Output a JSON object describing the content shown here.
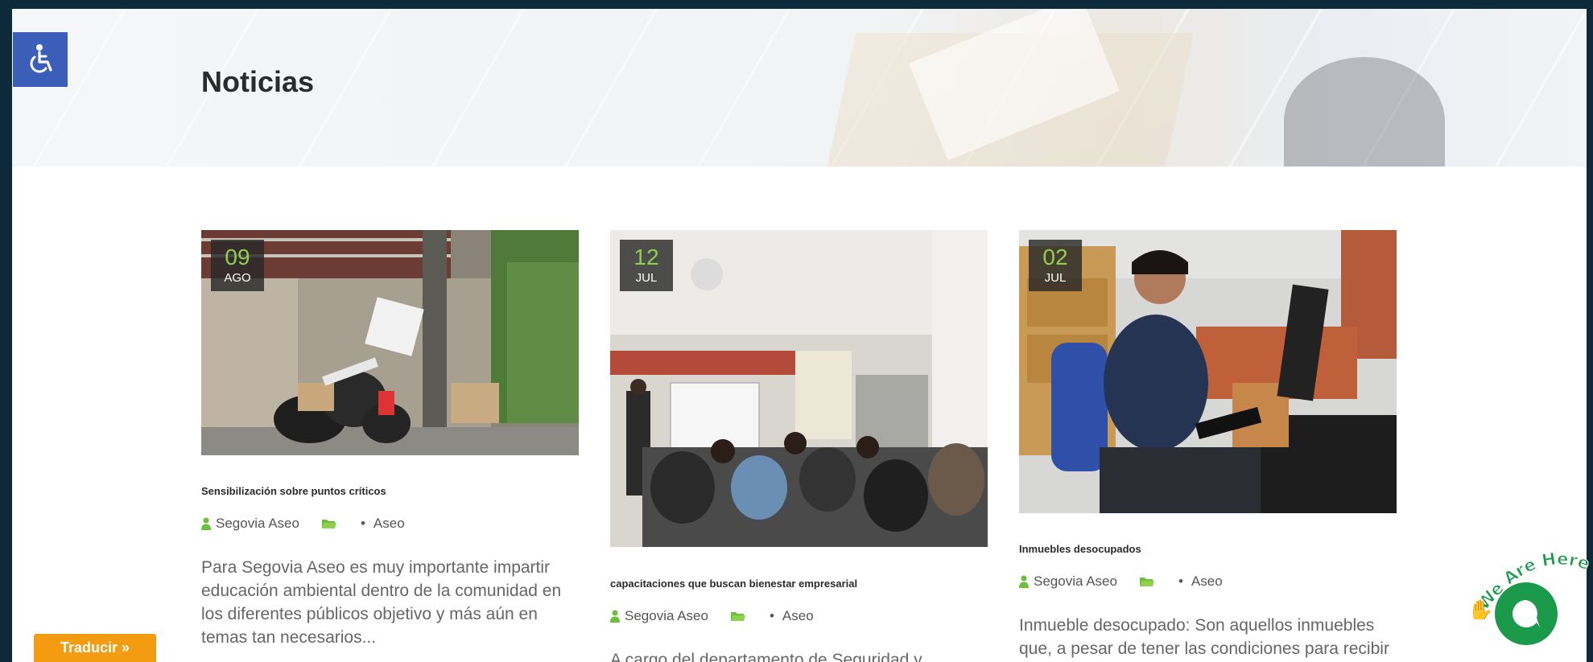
{
  "header": {
    "title": "Noticias"
  },
  "accessibility": {
    "icon": "wheelchair-icon"
  },
  "posts": [
    {
      "day": "09",
      "month": "AGO",
      "title": "Sensibilización sobre puntos críticos",
      "author": "Segovia Aseo",
      "category": "Aseo",
      "excerpt": "Para Segovia Aseo es muy importante impartir educación ambiental dentro de la comunidad en los diferentes públicos objetivo y más aún en temas tan necesarios..."
    },
    {
      "day": "12",
      "month": "JUL",
      "title": "capacitaciones que buscan bienestar empresarial",
      "author": "Segovia Aseo",
      "category": "Aseo",
      "excerpt": "A cargo del departamento de Seguridad y"
    },
    {
      "day": "02",
      "month": "JUL",
      "title": "Inmuebles desocupados",
      "author": "Segovia Aseo",
      "category": "Aseo",
      "excerpt": "Inmueble desocupado: Son aquellos inmuebles que, a pesar de tener las condiciones para recibir la prestación del"
    }
  ],
  "translate": {
    "label": "Traducir »"
  },
  "chat": {
    "label": "We Are Here!"
  },
  "colors": {
    "accent_green": "#8fd14f",
    "icon_green": "#6abf3c",
    "a11y_blue": "#3b5fb8",
    "translate_orange": "#f39c12",
    "chat_green": "#1c9a4b"
  }
}
